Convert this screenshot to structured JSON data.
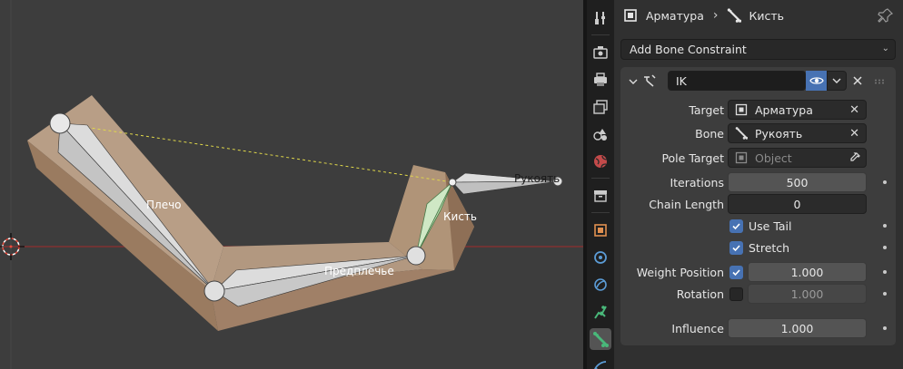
{
  "viewport": {
    "bones": [
      {
        "name": "Плечо"
      },
      {
        "name": "Предплечье"
      },
      {
        "name": "Кисть"
      },
      {
        "name": "Рукоять"
      }
    ],
    "colors": {
      "background": "#3d3d3d",
      "mesh": "#a98f78",
      "bone": "#d3d3d3",
      "active_bone": "#bfe3b8",
      "ik_line": "#e0d84a",
      "axis": "#8e2f2f"
    }
  },
  "tabs": [
    {
      "icon": "tool-icon"
    },
    {
      "icon": "render-icon"
    },
    {
      "icon": "output-icon"
    },
    {
      "icon": "view-layer-icon"
    },
    {
      "icon": "scene-icon"
    },
    {
      "icon": "world-icon"
    },
    {
      "icon": "collection-icon"
    },
    {
      "icon": "object-icon"
    },
    {
      "icon": "modifier-icon"
    },
    {
      "icon": "physics-icon"
    },
    {
      "icon": "object-constraint-icon"
    },
    {
      "icon": "bone-icon",
      "active": true
    },
    {
      "icon": "bone-constraint-icon"
    }
  ],
  "breadcrumb": {
    "object": "Арматура",
    "bone": "Кисть"
  },
  "add_constraint": {
    "label": "Add Bone Constraint"
  },
  "constraint": {
    "name": "IK",
    "target_label": "Target",
    "target_value": "Арматура",
    "bone_label": "Bone",
    "bone_value": "Рукоять",
    "pole_target_label": "Pole Target",
    "pole_target_placeholder": "Object",
    "iterations_label": "Iterations",
    "iterations_value": "500",
    "chain_length_label": "Chain Length",
    "chain_length_value": "0",
    "use_tail_label": "Use Tail",
    "use_tail": true,
    "stretch_label": "Stretch",
    "stretch": true,
    "weight_position_label": "Weight Position",
    "weight_position_enabled": true,
    "weight_position_value": "1.000",
    "rotation_label": "Rotation",
    "rotation_enabled": false,
    "rotation_value": "1.000",
    "influence_label": "Influence",
    "influence_value": "1.000"
  },
  "colors": {
    "accent": "#4772b3",
    "panel": "#3d3d3d",
    "field": "#2b2b2b"
  }
}
